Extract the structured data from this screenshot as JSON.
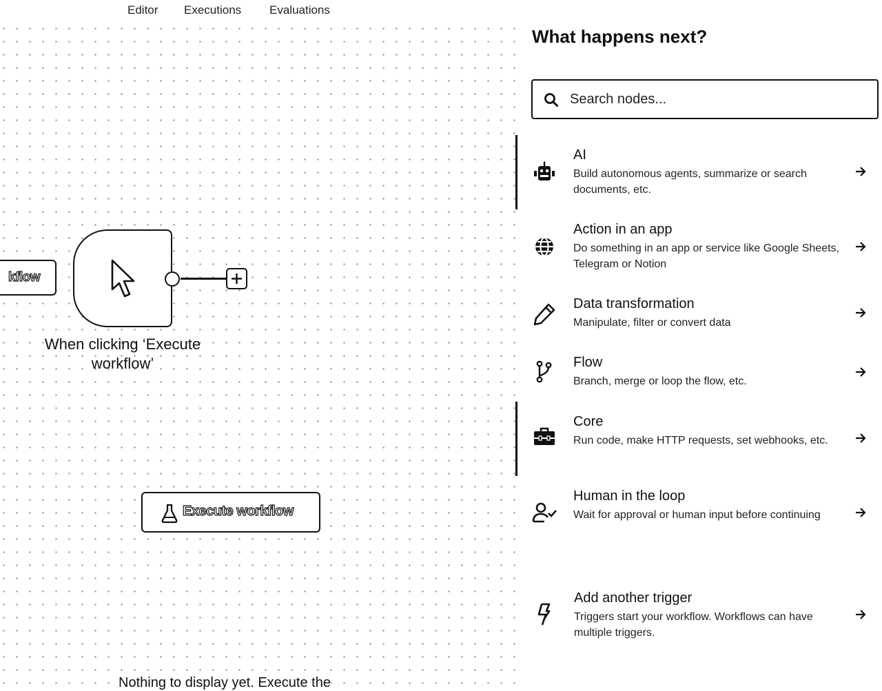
{
  "tabs": [
    "Editor",
    "Executions",
    "Evaluations"
  ],
  "canvas": {
    "partial_node_text": "kflow",
    "trigger_label": "When clicking ‘Execute workflow’",
    "execute_button": "Execute workflow",
    "empty_message": "Nothing to display yet. Execute the"
  },
  "panel": {
    "title": "What happens next?",
    "search_placeholder": "Search nodes...",
    "categories": [
      {
        "title": "AI",
        "description": "Build autonomous agents, summarize or search documents, etc.",
        "icon": "robot-icon"
      },
      {
        "title": "Action in an app",
        "description": "Do something in an app or service like Google Sheets, Telegram or Notion",
        "icon": "globe-icon"
      },
      {
        "title": "Data transformation",
        "description": "Manipulate, filter or convert data",
        "icon": "pen-icon"
      },
      {
        "title": "Flow",
        "description": "Branch, merge or loop the flow, etc.",
        "icon": "code-branch-icon"
      },
      {
        "title": "Core",
        "description": "Run code, make HTTP requests, set webhooks, etc.",
        "icon": "toolbox-icon"
      },
      {
        "title": "Human in the loop",
        "description": "Wait for approval or human input before continuing",
        "icon": "user-check-icon"
      }
    ],
    "trigger": {
      "title": "Add another trigger",
      "description": "Triggers start your workflow. Workflows can have multiple triggers.",
      "icon": "bolt-icon"
    }
  }
}
